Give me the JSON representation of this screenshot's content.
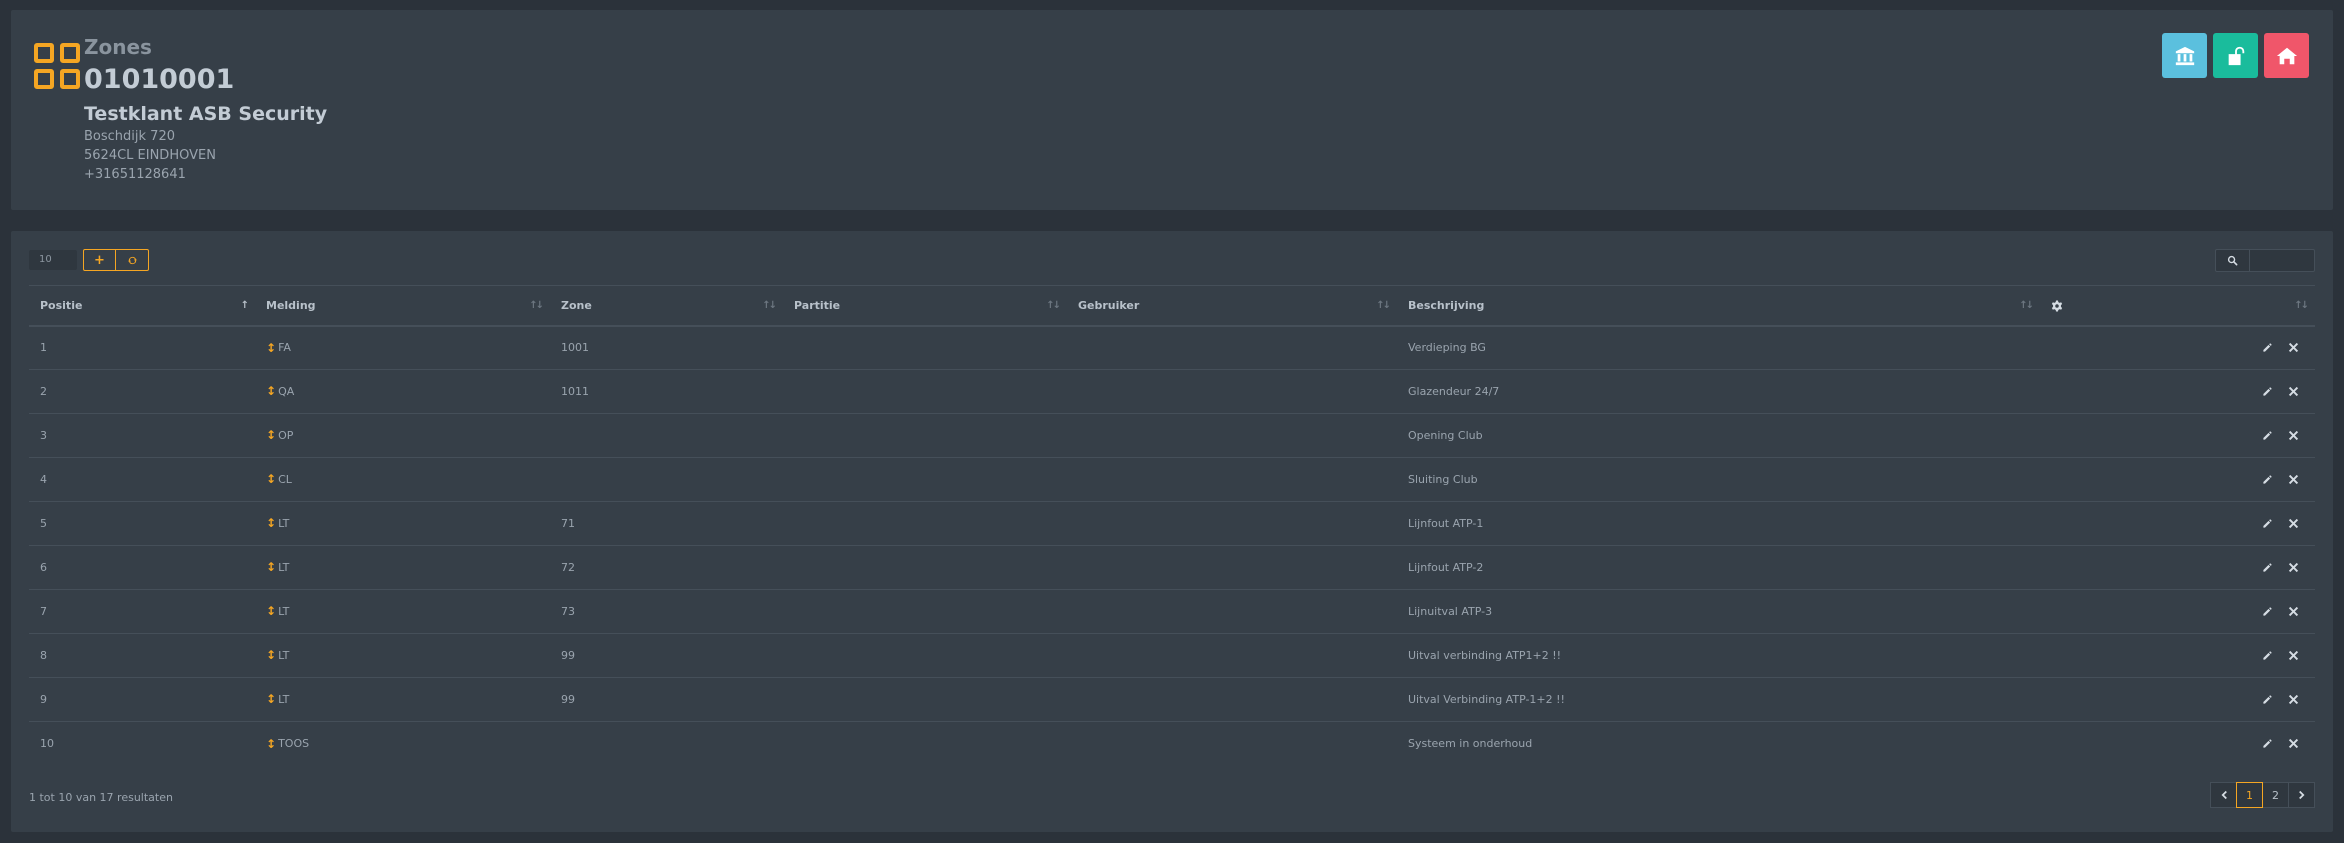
{
  "header": {
    "subtitle": "Zones",
    "account_id": "01010001",
    "client_name": "Testklant ASB Security",
    "address_line1": "Boschdijk 720",
    "address_line2": "5624CL EINDHOVEN",
    "phone": "+31651128641",
    "icon": "grid-icon",
    "actions": [
      {
        "name": "bank-button",
        "icon": "bank-icon",
        "color": "#5bc0de"
      },
      {
        "name": "unlock-button",
        "icon": "unlock-icon",
        "color": "#1abc9c"
      },
      {
        "name": "home-button",
        "icon": "home-icon",
        "color": "#f0566a"
      }
    ]
  },
  "toolbar": {
    "page_length": "10",
    "add_label": "+",
    "refresh_icon": "refresh-icon",
    "search_icon": "search-icon",
    "search_value": ""
  },
  "table": {
    "columns": [
      "Positie",
      "Melding",
      "Zone",
      "Partitie",
      "Gebruiker",
      "Beschrijving",
      ""
    ],
    "settings_icon": "gear-icon",
    "rows": [
      {
        "positie": "1",
        "melding": "FA",
        "zone": "1001",
        "partitie": "",
        "gebruiker": "",
        "beschrijving": "Verdieping BG"
      },
      {
        "positie": "2",
        "melding": "QA",
        "zone": "1011",
        "partitie": "",
        "gebruiker": "",
        "beschrijving": "Glazendeur 24/7"
      },
      {
        "positie": "3",
        "melding": "OP",
        "zone": "",
        "partitie": "",
        "gebruiker": "",
        "beschrijving": "Opening Club"
      },
      {
        "positie": "4",
        "melding": "CL",
        "zone": "",
        "partitie": "",
        "gebruiker": "",
        "beschrijving": "Sluiting Club"
      },
      {
        "positie": "5",
        "melding": "LT",
        "zone": "71",
        "partitie": "",
        "gebruiker": "",
        "beschrijving": "Lijnfout ATP-1"
      },
      {
        "positie": "6",
        "melding": "LT",
        "zone": "72",
        "partitie": "",
        "gebruiker": "",
        "beschrijving": "Lijnfout ATP-2"
      },
      {
        "positie": "7",
        "melding": "LT",
        "zone": "73",
        "partitie": "",
        "gebruiker": "",
        "beschrijving": "Lijnuitval ATP-3"
      },
      {
        "positie": "8",
        "melding": "LT",
        "zone": "99",
        "partitie": "",
        "gebruiker": "",
        "beschrijving": "Uitval verbinding ATP1+2 !!"
      },
      {
        "positie": "9",
        "melding": "LT",
        "zone": "99",
        "partitie": "",
        "gebruiker": "",
        "beschrijving": "Uitval Verbinding ATP-1+2 !!"
      },
      {
        "positie": "10",
        "melding": "TOOS",
        "zone": "",
        "partitie": "",
        "gebruiker": "",
        "beschrijving": "Systeem in onderhoud"
      }
    ]
  },
  "footer": {
    "info": "1 tot 10 van 17 resultaten",
    "pages": [
      "1",
      "2"
    ],
    "current_page": "1"
  },
  "colors": {
    "accent": "#f5a623",
    "panel": "#363f48",
    "background": "#2b323a"
  }
}
